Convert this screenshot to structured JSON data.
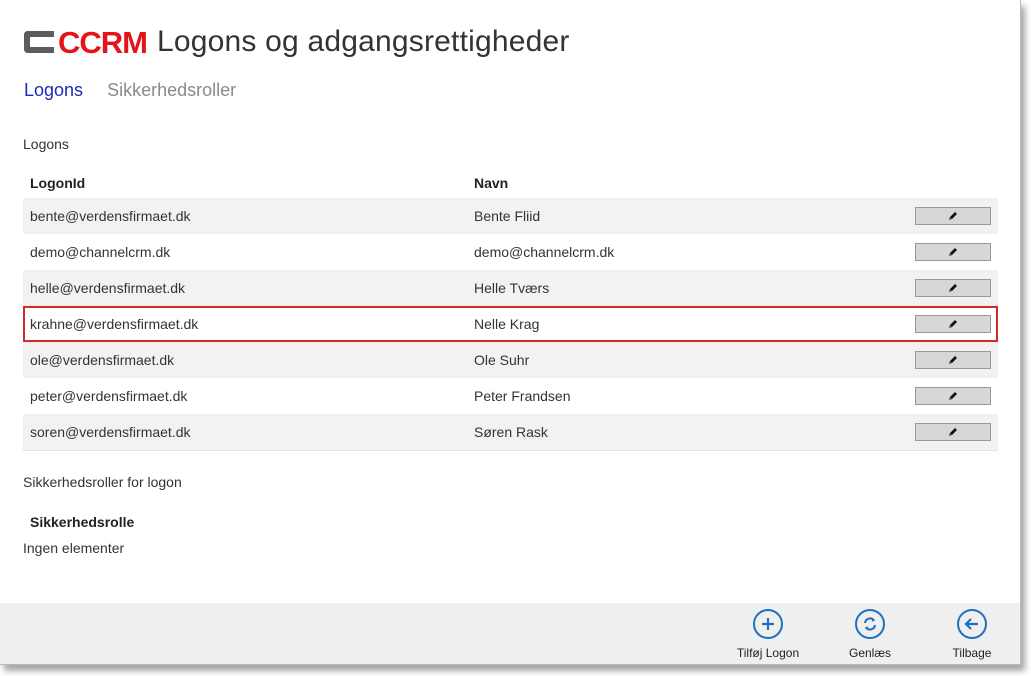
{
  "header": {
    "logo": "CCRM",
    "title": "Logons og adgangsrettigheder"
  },
  "tabs": [
    {
      "label": "Logons",
      "active": true
    },
    {
      "label": "Sikkerhedsroller",
      "active": false
    }
  ],
  "logons": {
    "section_label": "Logons",
    "columns": [
      "LogonId",
      "Navn"
    ],
    "rows": [
      {
        "id": "bente@verdensfirmaet.dk",
        "name": "Bente Fliid"
      },
      {
        "id": "demo@channelcrm.dk",
        "name": "demo@channelcrm.dk"
      },
      {
        "id": "helle@verdensfirmaet.dk",
        "name": "Helle Tværs"
      },
      {
        "id": "krahne@verdensfirmaet.dk",
        "name": "Nelle Krag"
      },
      {
        "id": "ole@verdensfirmaet.dk",
        "name": "Ole Suhr"
      },
      {
        "id": "peter@verdensfirmaet.dk",
        "name": "Peter Frandsen"
      },
      {
        "id": "soren@verdensfirmaet.dk",
        "name": "Søren Rask"
      }
    ],
    "selected_row": "krahne@verdensfirmaet.dk"
  },
  "roles": {
    "section_label": "Sikkerhedsroller for logon",
    "column": "Sikkerhedsrolle",
    "empty_text": "Ingen elementer"
  },
  "appbar": {
    "buttons": [
      {
        "label": "Tilføj Logon",
        "icon": "plus-circle-icon"
      },
      {
        "label": "Genlæs",
        "icon": "refresh-circle-icon"
      },
      {
        "label": "Tilbage",
        "icon": "back-arrow-circle-icon"
      }
    ]
  },
  "colors": {
    "accent": "#1e6fbf",
    "tab_active": "#1a2bb8",
    "logo_red": "#e4141b",
    "selection": "#d22a2a"
  }
}
